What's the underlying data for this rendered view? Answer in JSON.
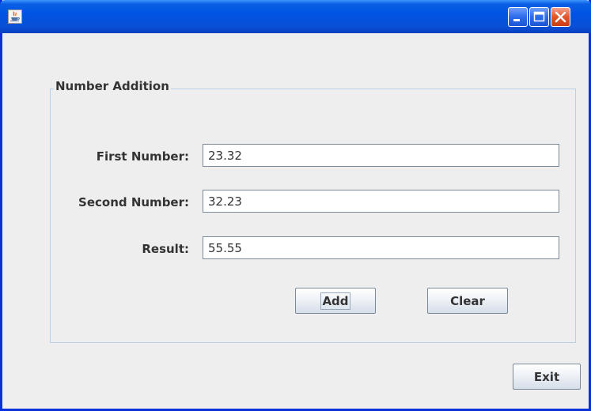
{
  "window": {
    "title": "",
    "controls": [
      "minimize-icon",
      "maximize-icon",
      "close-icon"
    ],
    "accent": "#0054e3"
  },
  "panel": {
    "title": "Number Addition",
    "first_number_label": "First Number:",
    "first_number_value": "23.32",
    "second_number_label": "Second Number:",
    "second_number_value": "32.23",
    "result_label": "Result:",
    "result_value": "55.55",
    "add_label": "Add",
    "clear_label": "Clear"
  },
  "footer": {
    "exit_label": "Exit"
  }
}
